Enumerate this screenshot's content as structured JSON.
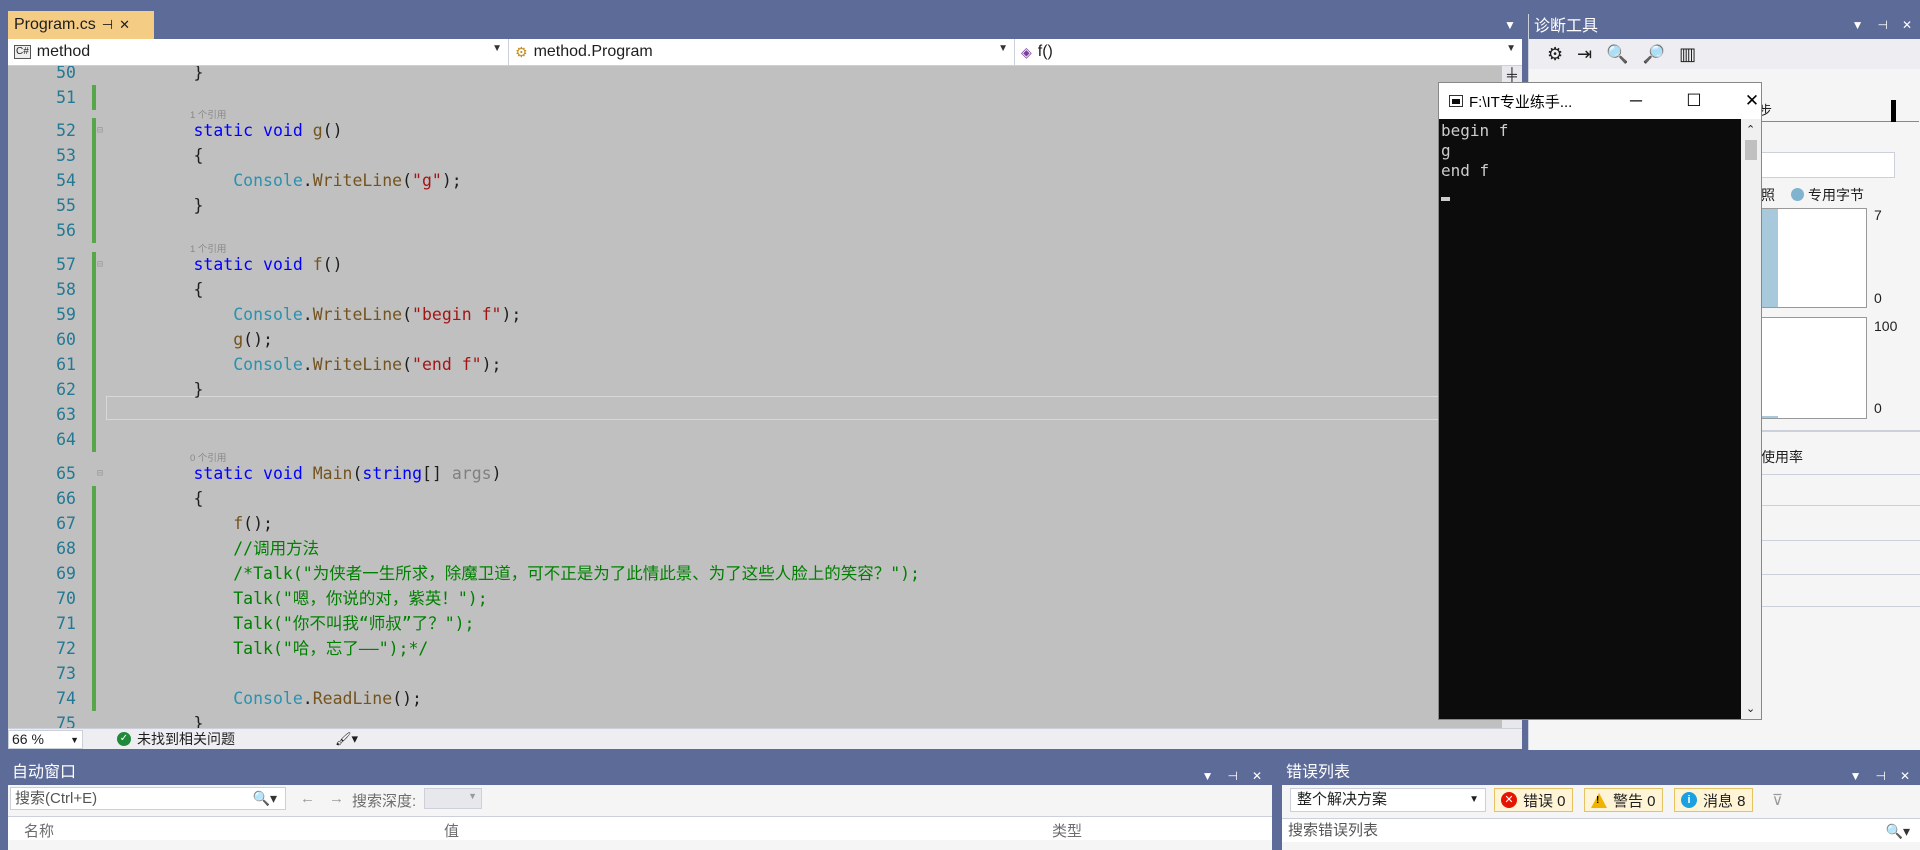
{
  "tab": {
    "title": "Program.cs",
    "pin": "⊣",
    "close": "✕"
  },
  "nav": {
    "project": "method",
    "class": "method.Program",
    "member": "f()"
  },
  "code_lines": [
    {
      "n": "50",
      "html": "        }"
    },
    {
      "n": "51",
      "html": ""
    },
    {
      "n": "52",
      "hint": "1 个引用",
      "html": "        <span class='kw'>static</span> <span class='kw'>void</span> <span class='mt'>g</span>()"
    },
    {
      "n": "53",
      "html": "        {"
    },
    {
      "n": "54",
      "html": "            <span class='tp'>Console</span>.<span class='mt'>WriteLine</span>(<span class='st'>\"g\"</span>);"
    },
    {
      "n": "55",
      "html": "        }"
    },
    {
      "n": "56",
      "html": ""
    },
    {
      "n": "57",
      "hint": "1 个引用",
      "html": "        <span class='kw'>static</span> <span class='kw'>void</span> <span class='mt'>f</span>()"
    },
    {
      "n": "58",
      "html": "        {"
    },
    {
      "n": "59",
      "html": "            <span class='tp'>Console</span>.<span class='mt'>WriteLine</span>(<span class='st'>\"begin f\"</span>);"
    },
    {
      "n": "60",
      "html": "            <span class='mt'>g</span>();"
    },
    {
      "n": "61",
      "html": "            <span class='tp'>Console</span>.<span class='mt'>WriteLine</span>(<span class='st'>\"end f\"</span>);"
    },
    {
      "n": "62",
      "html": "        }"
    },
    {
      "n": "63",
      "html": ""
    },
    {
      "n": "64",
      "html": ""
    },
    {
      "n": "65",
      "hint": "0 个引用",
      "html": "        <span class='kw'>static</span> <span class='kw'>void</span> <span class='mt'>Main</span>(<span class='kw'>string</span>[] <span class='pm'>args</span>)"
    },
    {
      "n": "66",
      "html": "        {"
    },
    {
      "n": "67",
      "html": "            <span class='mt'>f</span>();"
    },
    {
      "n": "68",
      "html": "            <span class='cm'>//调用方法</span>"
    },
    {
      "n": "69",
      "html": "            <span class='cm'>/*Talk(\"为侠者一生所求，除魔卫道，可不正是为了此情此景、为了这些人脸上的笑容？\");</span>"
    },
    {
      "n": "70",
      "html": "            <span class='cm'>Talk(\"嗯，你说的对，紫英！\");</span>"
    },
    {
      "n": "71",
      "html": "            <span class='cm'>Talk(\"你不叫我“师叔”了？\");</span>"
    },
    {
      "n": "72",
      "html": "            <span class='cm'>Talk(\"哈，忘了——\");*/</span>"
    },
    {
      "n": "73",
      "html": ""
    },
    {
      "n": "74",
      "html": "            <span class='tp'>Console</span>.<span class='mt'>ReadLine</span>();"
    },
    {
      "n": "75",
      "html": "        }"
    }
  ],
  "editor_status": {
    "zoom": "66 %",
    "issues": "未找到相关问题"
  },
  "console": {
    "title": "F:\\IT专业练手...",
    "output": "begin f\ng\nend f\n"
  },
  "diag": {
    "title": "诊断工具",
    "ruler_label": "步",
    "legend_left": "照",
    "legend_right": "专用字节",
    "chart1_max": "7",
    "chart1_min": "0",
    "chart2_max": "100",
    "chart2_min": "0",
    "usage_label": "使用率",
    "colors": {
      "bar": "#a8c8dc"
    }
  },
  "autos": {
    "title": "自动窗口",
    "search_placeholder": "搜索(Ctrl+E)",
    "depth_label": "搜索深度:",
    "col_name": "名称",
    "col_value": "值",
    "col_type": "类型"
  },
  "errors": {
    "title": "错误列表",
    "scope": "整个解决方案",
    "errors_label": "错误 0",
    "warnings_label": "警告 0",
    "messages_label": "消息 8",
    "search_placeholder": "搜索错误列表"
  }
}
